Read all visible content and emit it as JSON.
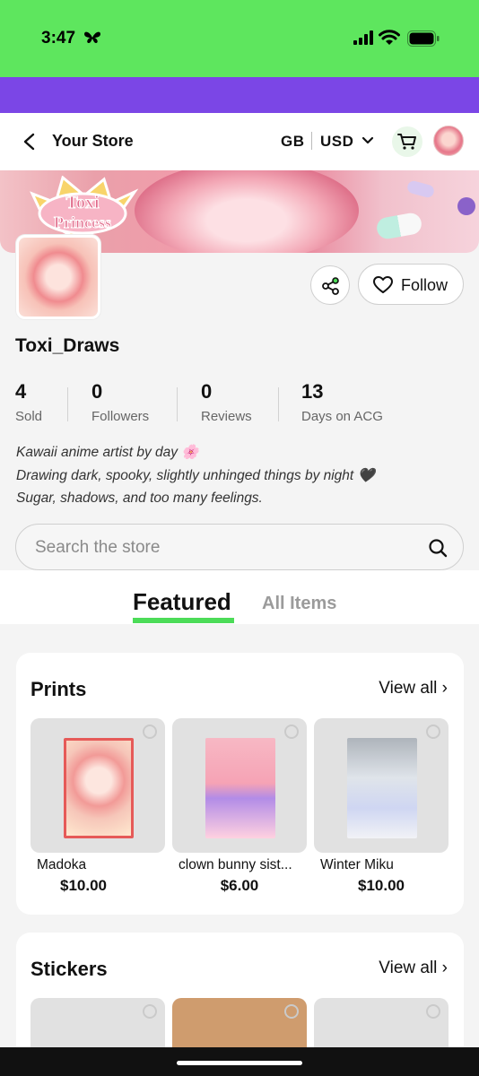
{
  "status_bar": {
    "time": "3:47"
  },
  "header": {
    "title": "Your Store",
    "region": "GB",
    "currency": "USD"
  },
  "store": {
    "name": "Toxi_Draws",
    "follow_label": "Follow",
    "banner_text": "Toxi Princess",
    "stats": [
      {
        "value": "4",
        "label": "Sold"
      },
      {
        "value": "0",
        "label": "Followers"
      },
      {
        "value": "0",
        "label": "Reviews"
      },
      {
        "value": "13",
        "label": "Days on ACG"
      }
    ],
    "bio": [
      "Kawaii anime artist by day 🌸",
      "Drawing dark, spooky, slightly unhinged things by night 🖤",
      "Sugar, shadows, and too many feelings."
    ]
  },
  "search": {
    "placeholder": "Search the store"
  },
  "tabs": [
    {
      "label": "Featured",
      "active": true
    },
    {
      "label": "All Items",
      "active": false
    }
  ],
  "sections": [
    {
      "title": "Prints",
      "view_all": "View all ›",
      "items": [
        {
          "name": "Madoka",
          "price": "$10.00"
        },
        {
          "name": "clown bunny sist...",
          "price": "$6.00"
        },
        {
          "name": "Winter Miku",
          "price": "$10.00"
        }
      ]
    },
    {
      "title": "Stickers",
      "view_all": "View all ›"
    }
  ],
  "colors": {
    "status_bar": "#5ee65e",
    "accent_band": "#7b46e6",
    "tab_underline": "#4cdc58"
  }
}
